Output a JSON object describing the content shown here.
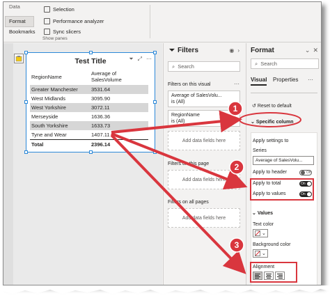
{
  "ribbon": {
    "item_data": "Data",
    "item_selection": "Selection",
    "item_format": "Format",
    "item_performance": "Performance analyzer",
    "item_bookmarks": "Bookmarks",
    "item_sync": "Sync slicers",
    "group_label": "Show panes"
  },
  "visual": {
    "title": "Test Title",
    "col1": "RegionName",
    "col2": "Average of SalesVolume",
    "rows": [
      {
        "region": "Greater Manchester",
        "value": "3531.64"
      },
      {
        "region": "West Midlands",
        "value": "3095.90"
      },
      {
        "region": "West Yorkshire",
        "value": "3072.11"
      },
      {
        "region": "Merseyside",
        "value": "1636.36"
      },
      {
        "region": "South Yorkshire",
        "value": "1633.73"
      },
      {
        "region": "Tyne and Wear",
        "value": "1407.11"
      }
    ],
    "total_label": "Total",
    "total_value": "2396.14"
  },
  "filters": {
    "title": "Filters",
    "search_placeholder": "Search",
    "section_visual": "Filters on this visual",
    "card1_line1": "Average of SalesVolu...",
    "card1_line2": "is (All)",
    "card2_line1": "RegionName",
    "card2_line2": "is (All)",
    "add_fields": "Add data fields here",
    "section_page": "Filters on this page",
    "section_all": "Filters on all pages"
  },
  "format": {
    "title": "Format",
    "search_placeholder": "Search",
    "tab_visual": "Visual",
    "tab_properties": "Properties",
    "reset": "Reset to default",
    "specific_column": "Specific column",
    "apply_settings": "Apply settings to",
    "series_label": "Series",
    "series_value": "Average of SalesVolu...",
    "apply_header": "Apply to header",
    "apply_header_state": "Off",
    "apply_total": "Apply to total",
    "apply_total_state": "On",
    "apply_values": "Apply to values",
    "apply_values_state": "On",
    "values_section": "Values",
    "text_color": "Text color",
    "background_color": "Background color",
    "alignment": "Alignment"
  },
  "annotations": {
    "step1": "1",
    "step2": "2",
    "step3": "3"
  },
  "colors": {
    "accent_red": "#d9363e",
    "selection_blue": "#2b88d8",
    "row_band": "#d6d6d6"
  }
}
